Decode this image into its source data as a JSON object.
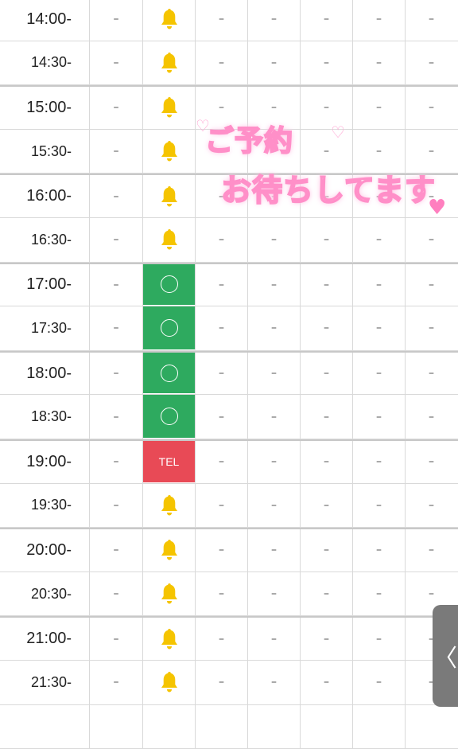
{
  "schedule": {
    "dash": "–",
    "rows": [
      {
        "time": "14:00-",
        "status": "bell"
      },
      {
        "time": "14:30-",
        "status": "bell"
      },
      {
        "time": "15:00-",
        "status": "bell"
      },
      {
        "time": "15:30-",
        "status": "bell"
      },
      {
        "time": "16:00-",
        "status": "bell"
      },
      {
        "time": "16:30-",
        "status": "bell"
      },
      {
        "time": "17:00-",
        "status": "available"
      },
      {
        "time": "17:30-",
        "status": "available"
      },
      {
        "time": "18:00-",
        "status": "available"
      },
      {
        "time": "18:30-",
        "status": "available"
      },
      {
        "time": "19:00-",
        "status": "tel",
        "label": "TEL"
      },
      {
        "time": "19:30-",
        "status": "bell"
      },
      {
        "time": "20:00-",
        "status": "bell"
      },
      {
        "time": "20:30-",
        "status": "bell"
      },
      {
        "time": "21:00-",
        "status": "bell"
      },
      {
        "time": "21:30-",
        "status": "bell"
      },
      {
        "time": "",
        "status": "partial"
      }
    ]
  },
  "sticker": {
    "line1": "ご予約",
    "line2": "お待ちしてます"
  },
  "side_handle": {
    "icon": "chevron-left-icon",
    "glyph": "〈"
  },
  "colors": {
    "available": "#2eaa5f",
    "tel": "#e84a56",
    "bell": "#f5c400",
    "sticker_outline": "#ff8fc8"
  }
}
